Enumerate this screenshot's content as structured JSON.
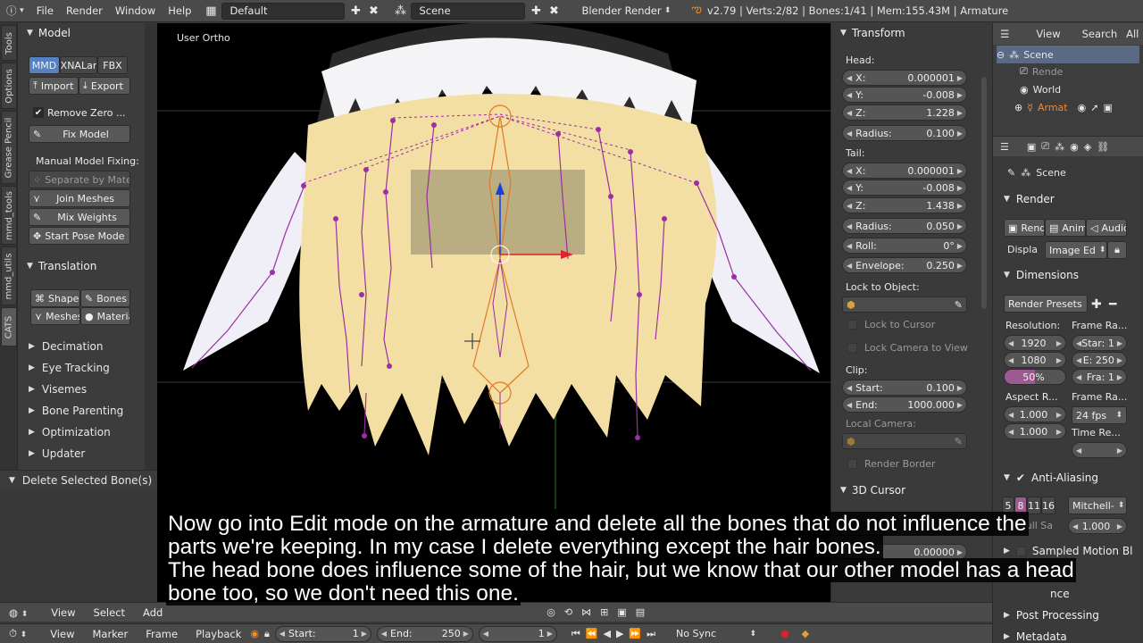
{
  "topbar": {
    "menus": [
      "File",
      "Render",
      "Window",
      "Help"
    ],
    "layout": "Default",
    "scene": "Scene",
    "engine": "Blender Render",
    "stats": "v2.79 | Verts:2/82 | Bones:1/41 | Mem:155.43M | Armature"
  },
  "left_tabs": [
    "Tools",
    "Options",
    "Grease Pencil",
    "mmd_tools",
    "mmd_utils",
    "CATS"
  ],
  "toolshelf": {
    "model_header": "Model",
    "format_tabs": [
      "MMD",
      "XNALar",
      "FBX"
    ],
    "import_label": "Import",
    "export_label": "Export",
    "remove_zero_label": "Remove Zero ...",
    "fix_model_label": "Fix Model",
    "manual_fixing_label": "Manual Model Fixing:",
    "separate_label": "Separate by Mate...",
    "join_meshes_label": "Join Meshes",
    "mix_weights_label": "Mix Weights",
    "start_pose_label": "Start Pose Mode",
    "translation_header": "Translation",
    "shape_keys_label": "Shape K",
    "bones_label": "Bones",
    "meshes_label": "Meshes",
    "material_label": "Material",
    "sections": [
      "Decimation",
      "Eye Tracking",
      "Visemes",
      "Bone Parenting",
      "Optimization",
      "Updater"
    ]
  },
  "operator": {
    "label": "Delete Selected Bone(s)"
  },
  "viewport": {
    "label": "User Ortho"
  },
  "transform": {
    "header": "Transform",
    "head_label": "Head:",
    "head_x": "0.000001",
    "head_y": "-0.008",
    "head_z": "1.228",
    "radius_head": "0.100",
    "tail_label": "Tail:",
    "tail_x": "0.000001",
    "tail_y": "-0.008",
    "tail_z": "1.438",
    "radius_tail": "0.050",
    "roll": "0°",
    "envelope": "0.250",
    "lock_to_object": "Lock to Object:",
    "lock_to_cursor": "Lock to Cursor",
    "lock_camera": "Lock Camera to View",
    "clip_label": "Clip:",
    "clip_start": "0.100",
    "clip_end": "1000.000",
    "local_camera": "Local Camera:",
    "render_border": "Render Border",
    "cursor_header": "3D Cursor",
    "cursor_value": "0.00000"
  },
  "field_keys": {
    "x": "X:",
    "y": "Y:",
    "z": "Z:",
    "radius": "Radius:",
    "roll": "Roll:",
    "envelope": "Envelope:",
    "start": "Start:",
    "end": "End:"
  },
  "outliner": {
    "view": "View",
    "search": "Search",
    "all": "All",
    "scene": "Scene",
    "render": "Rende",
    "world": "World",
    "armature": "Armat"
  },
  "properties": {
    "scene": "Scene",
    "render_header": "Render",
    "render_btn": "Rend",
    "anim_btn": "Anim",
    "audio_btn": "Audio",
    "display_label": "Displa",
    "display_value": "Image Ed",
    "dimensions_header": "Dimensions",
    "presets": "Render Presets",
    "resolution_label": "Resolution:",
    "frame_range_label": "Frame Ra...",
    "res_x": "1920",
    "res_y": "1080",
    "res_pct": "50%",
    "start": "Star: 1",
    "end": "E: 250",
    "frame": "Fra: 1",
    "aspect_label": "Aspect R...",
    "frame_rate_label": "Frame Ra...",
    "aspect_x": "1.000",
    "aspect_y": "1.000",
    "fps": "24 fps",
    "time_label": "Time Re...",
    "aa_header": "Anti-Aliasing",
    "aa_samples": [
      "5",
      "8",
      "11",
      "16"
    ],
    "aa_filter": "Mitchell-",
    "full_sample": "Full Sa",
    "filter_size": "1.000",
    "motion_blur": "Sampled Motion Bl",
    "shading_partial": "nce",
    "post_processing": "Post Processing",
    "metadata": "Metadata"
  },
  "vp_header": {
    "menus": [
      "View",
      "Select",
      "Add"
    ]
  },
  "timeline": {
    "menus": [
      "View",
      "Marker",
      "Frame",
      "Playback"
    ],
    "start_label": "Start:",
    "start": "1",
    "end_label": "End:",
    "end": "250",
    "current": "1",
    "sync": "No Sync"
  },
  "subtitle": {
    "line1": "Now go into Edit mode on the armature and delete all the bones that do not influence the",
    "line2": "parts we're keeping. In my case I delete everything except the hair bones.",
    "line3": "The head bone does influence some of the hair, but we know that our other model has a head",
    "line4": "bone too, so we don't need this one."
  },
  "colors": {
    "accent": "#5680c2",
    "bone": "#9b2fa3",
    "active_bone": "#e07a22",
    "hair": "#f3dfa3"
  }
}
